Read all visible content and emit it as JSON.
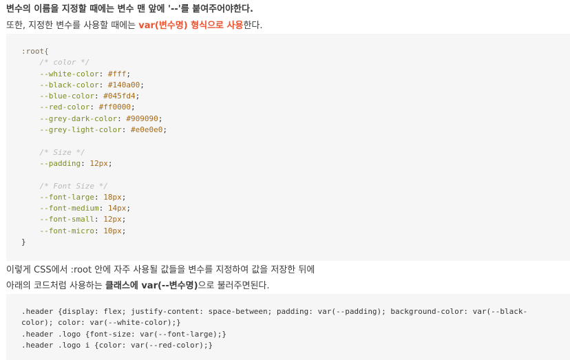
{
  "para1": {
    "line1": "변수의 이름을 지정할 때에는 변수 맨 앞에 '--'를 붙여주어야한다.",
    "line2_prefix": "또한, 지정한 변수를 사용할 때에는 ",
    "line2_highlight": "var(변수명) 형식으로 사용",
    "line2_suffix": "한다."
  },
  "code_block_1": {
    "root_open": ":root{",
    "comment_color": "/* color */",
    "vars_color": [
      {
        "name": "--white-color",
        "value": "#fff"
      },
      {
        "name": "--black-color",
        "value": "#140a00"
      },
      {
        "name": "--blue-color",
        "value": "#045fd4"
      },
      {
        "name": "--red-color",
        "value": "#ff0000"
      },
      {
        "name": "--grey-dark-color",
        "value": "#909090"
      },
      {
        "name": "--grey-light-color",
        "value": "#e0e0e0"
      }
    ],
    "comment_size": "/* Size */",
    "var_padding": {
      "name": "--padding",
      "value": "12px"
    },
    "comment_font": "/* Font Size */",
    "vars_font": [
      {
        "name": "--font-large",
        "value": "18px"
      },
      {
        "name": "--font-medium",
        "value": "14px"
      },
      {
        "name": "--font-small",
        "value": "12px"
      },
      {
        "name": "--font-micro",
        "value": "10px"
      }
    ],
    "root_close": "}"
  },
  "para2": {
    "line1": "이렇게 CSS에서 :root 안에 자주 사용될 값들을 변수를 지정하여 값을 저장한 뒤에",
    "line2_prefix": "아래의 코드처럼 사용하는 ",
    "line2_bold": "클래스에 var(--변수명)",
    "line2_suffix": "으로 불러주면된다."
  },
  "code_block_2": {
    "line1": ".header {display: flex; justify-content: space-between; padding: var(--padding); background-color: var(--black-",
    "line2": "color); color: var(--white-color);}",
    "line3": ".header .logo {font-size: var(--font-large);}",
    "line4": ".header .logo i {color: var(--red-color);}"
  },
  "colors": {
    "accent": "#e8542f",
    "code_background": "#f6f6f6",
    "comment": "#b9b9b9",
    "property": "#7b8c1f",
    "value": "#a46a19"
  }
}
